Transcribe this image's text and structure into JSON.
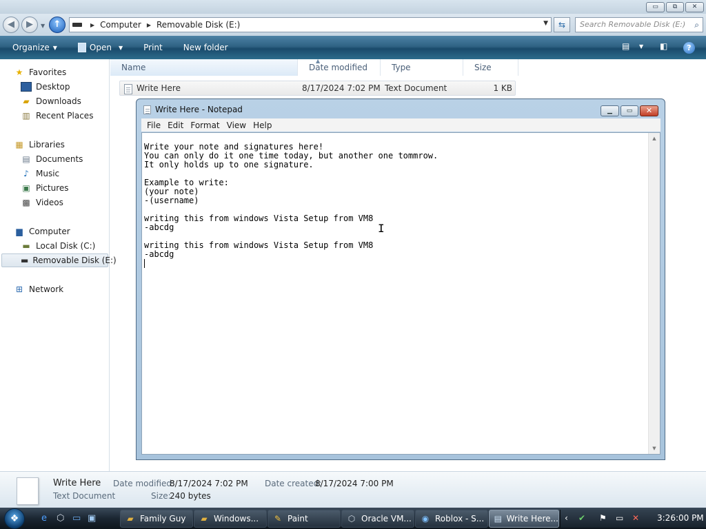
{
  "explorer": {
    "caption_buttons": {
      "minimize": "▭",
      "maximize": "⧉",
      "close": "✕"
    },
    "address": {
      "root_icon": "drive-icon",
      "crumbs": [
        "Computer",
        "Removable Disk (E:)"
      ]
    },
    "search": {
      "placeholder": "Search Removable Disk (E:)"
    },
    "toolbar": {
      "organize": "Organize",
      "open": "Open",
      "print": "Print",
      "new_folder": "New folder"
    },
    "nav": {
      "favorites": "Favorites",
      "desktop": "Desktop",
      "downloads": "Downloads",
      "recent_places": "Recent Places",
      "libraries": "Libraries",
      "documents": "Documents",
      "music": "Music",
      "pictures": "Pictures",
      "videos": "Videos",
      "computer": "Computer",
      "local_disk": "Local Disk (C:)",
      "removable_disk": "Removable Disk (E:)",
      "network": "Network"
    },
    "columns": {
      "name": "Name",
      "date_modified": "Date modified",
      "type": "Type",
      "size": "Size"
    },
    "files": [
      {
        "name": "Write Here",
        "date_modified": "8/17/2024 7:02 PM",
        "type": "Text Document",
        "size": "1 KB"
      }
    ],
    "details": {
      "name": "Write Here",
      "type": "Text Document",
      "date_modified_label": "Date modified:",
      "date_modified": "8/17/2024 7:02 PM",
      "date_created_label": "Date created:",
      "date_created": "8/17/2024 7:00 PM",
      "size_label": "Size:",
      "size": "240 bytes"
    }
  },
  "notepad": {
    "title": "Write Here - Notepad",
    "menu": [
      "File",
      "Edit",
      "Format",
      "View",
      "Help"
    ],
    "content": "Write your note and signatures here!\nYou can only do it one time today, but another one tommrow.\nIt only holds up to one signature.\n\nExample to write:\n(your note)\n-(username)\n\nwriting this from windows Vista Setup from VM8\n-abcdg\n\nwriting this from windows Vista Setup from VM8\n-abcdg\n"
  },
  "taskbar": {
    "tasks": [
      {
        "label": "Family Guy",
        "icon": "folder-icon"
      },
      {
        "label": "Windows...",
        "icon": "folder-icon"
      },
      {
        "label": "Paint",
        "icon": "paint-icon"
      },
      {
        "label": "Oracle VM...",
        "icon": "virtualbox-icon"
      },
      {
        "label": "Roblox - S...",
        "icon": "browser-icon"
      },
      {
        "label": "Write Here...",
        "icon": "notepad-icon"
      }
    ],
    "clock": "3:26:00 PM"
  },
  "colors": {
    "toolbar": "#2f6283",
    "selection": "#dde6ee",
    "taskbar": "#1b2632",
    "close_button": "#c8452b"
  }
}
